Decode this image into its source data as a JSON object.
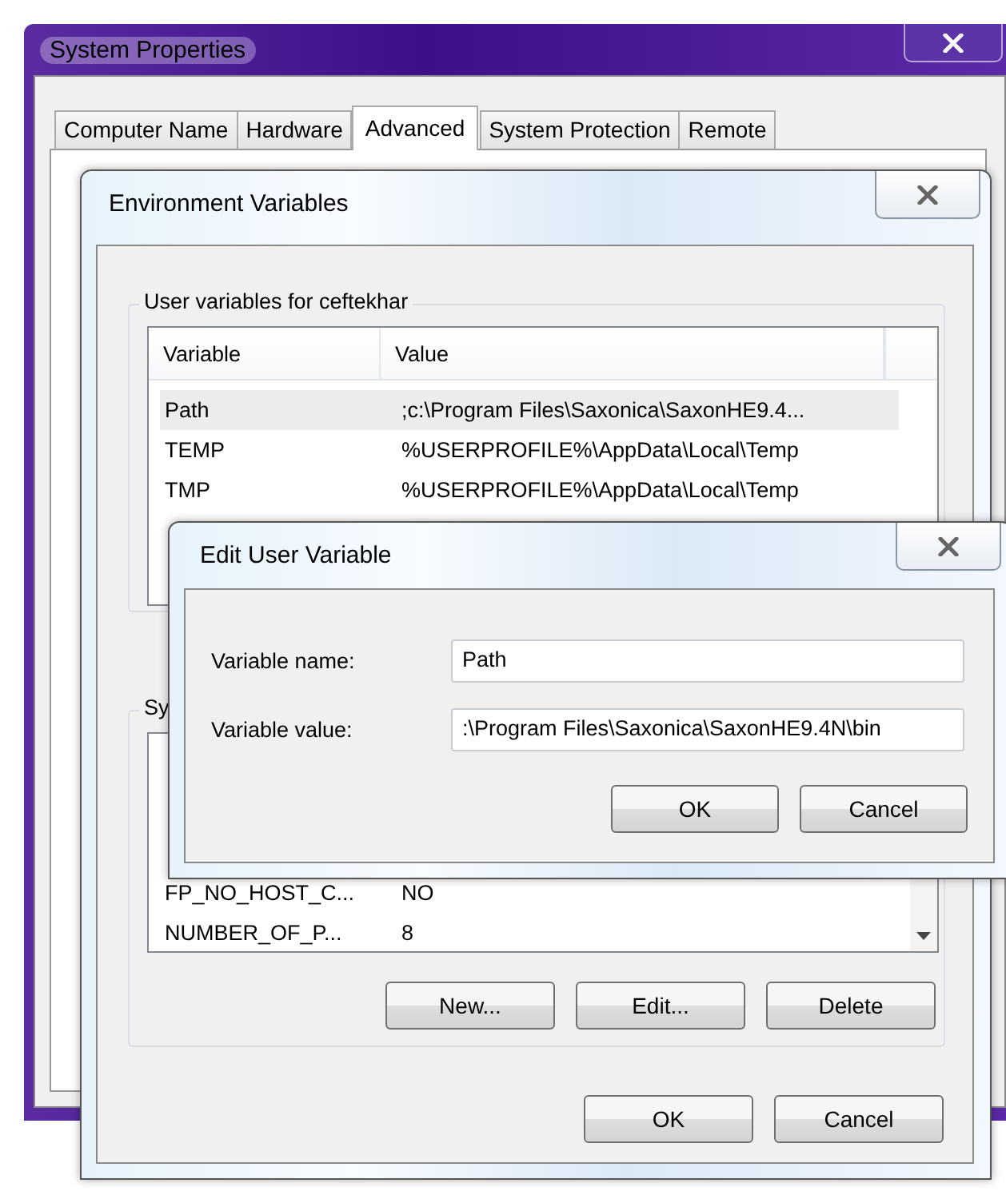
{
  "system_properties": {
    "title": "System Properties",
    "tabs": [
      {
        "label": "Computer Name",
        "selected": false
      },
      {
        "label": "Hardware",
        "selected": false
      },
      {
        "label": "Advanced",
        "selected": true
      },
      {
        "label": "System Protection",
        "selected": false
      },
      {
        "label": "Remote",
        "selected": false
      }
    ]
  },
  "environment_variables": {
    "title": "Environment Variables",
    "user_variables": {
      "label": "User variables for ceftekhar",
      "columns": [
        "Variable",
        "Value"
      ],
      "rows": [
        {
          "variable": "Path",
          "value": ";c:\\Program Files\\Saxonica\\SaxonHE9.4...",
          "selected": true
        },
        {
          "variable": "TEMP",
          "value": "%USERPROFILE%\\AppData\\Local\\Temp",
          "selected": false
        },
        {
          "variable": "TMP",
          "value": "%USERPROFILE%\\AppData\\Local\\Temp",
          "selected": false
        }
      ]
    },
    "system_variables": {
      "label": "Sy",
      "rows": [
        {
          "variable": "FP_NO_HOST_C...",
          "value": "NO",
          "selected": false
        },
        {
          "variable": "NUMBER_OF_P...",
          "value": "8",
          "selected": false
        }
      ]
    },
    "list_buttons": [
      "New...",
      "Edit...",
      "Delete"
    ],
    "dialog_buttons": [
      "OK",
      "Cancel"
    ]
  },
  "edit_user_variable": {
    "title": "Edit User Variable",
    "fields": [
      {
        "label": "Variable name:",
        "value": "Path"
      },
      {
        "label": "Variable value:",
        "value": ":\\Program Files\\Saxonica\\SaxonHE9.4N\\bin"
      }
    ],
    "buttons": [
      "OK",
      "Cancel"
    ]
  }
}
